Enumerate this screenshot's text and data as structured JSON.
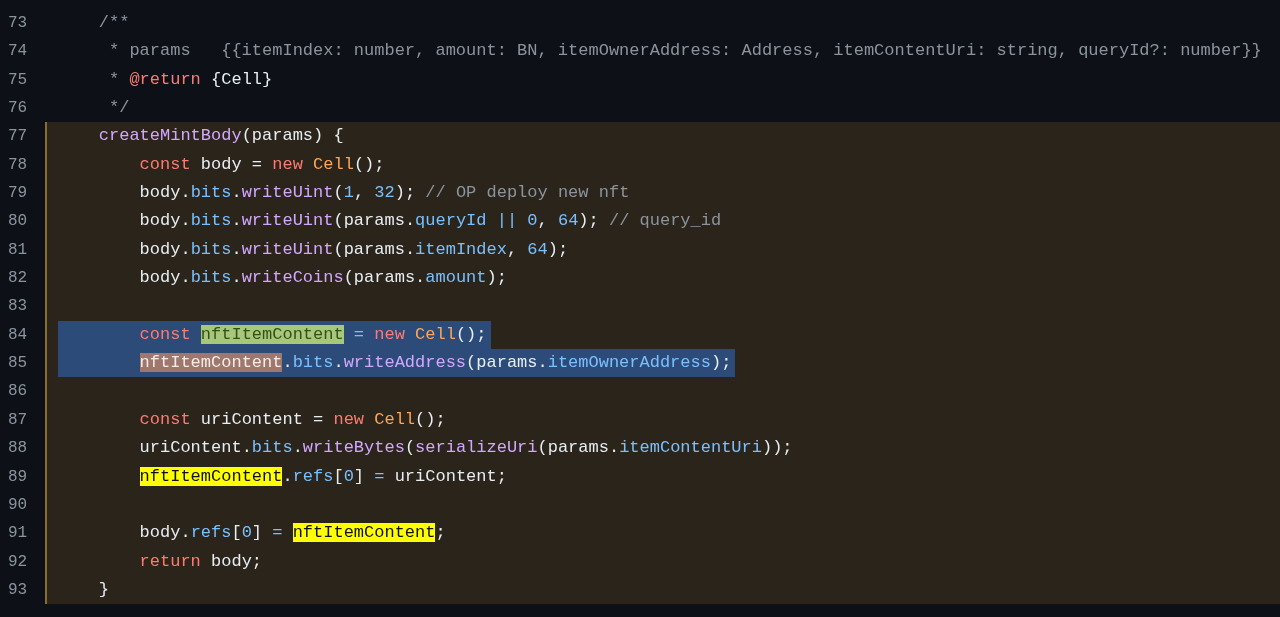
{
  "lines": [
    {
      "number": "73",
      "in_block": false,
      "selected": false,
      "tokens": [
        {
          "text": "/**",
          "kind": "comment"
        }
      ]
    },
    {
      "number": "74",
      "in_block": false,
      "selected": false,
      "tokens": [
        {
          "text": " * params   {{itemIndex: number, amount: BN, itemOwnerAddress: Address, itemContentUri: string, queryId?: number}}",
          "kind": "comment"
        }
      ]
    },
    {
      "number": "75",
      "in_block": false,
      "selected": false,
      "tokens": [
        {
          "text": " * ",
          "kind": "comment"
        },
        {
          "text": "@return",
          "kind": "keyword"
        },
        {
          "text": " {Cell}",
          "kind": "plain"
        }
      ]
    },
    {
      "number": "76",
      "in_block": false,
      "selected": false,
      "tokens": [
        {
          "text": " */",
          "kind": "comment"
        }
      ]
    },
    {
      "number": "77",
      "in_block": true,
      "selected": false,
      "tokens": [
        {
          "text": "createMintBody",
          "kind": "function"
        },
        {
          "text": "(params) {",
          "kind": "plain"
        }
      ],
      "children": [
        {
          "number": "78",
          "in_block": true,
          "selected": false,
          "tokens": [
            {
              "text": "const",
              "kind": "keyword"
            },
            {
              "text": " body = ",
              "kind": "plain"
            },
            {
              "text": "new",
              "kind": "keyword"
            },
            {
              "text": " Cell",
              "kind": "class"
            },
            {
              "text": "();",
              "kind": "plain"
            }
          ]
        },
        {
          "number": "79",
          "in_block": true,
          "selected": false,
          "tokens": [
            {
              "text": "body.",
              "kind": "plain"
            },
            {
              "text": "bits",
              "kind": "property"
            },
            {
              "text": ".",
              "kind": "plain"
            },
            {
              "text": "writeUint",
              "kind": "function"
            },
            {
              "text": "(",
              "kind": "plain"
            },
            {
              "text": "1",
              "kind": "number"
            },
            {
              "text": ", ",
              "kind": "plain"
            },
            {
              "text": "32",
              "kind": "number"
            },
            {
              "text": "); ",
              "kind": "plain"
            },
            {
              "text": "// OP deploy new nft",
              "kind": "comment"
            }
          ]
        },
        {
          "number": "80",
          "in_block": true,
          "selected": false,
          "tokens": [
            {
              "text": "body.",
              "kind": "plain"
            },
            {
              "text": "bits",
              "kind": "property"
            },
            {
              "text": ".",
              "kind": "plain"
            },
            {
              "text": "writeUint",
              "kind": "function"
            },
            {
              "text": "(params.",
              "kind": "plain"
            },
            {
              "text": "queryId",
              "kind": "property"
            },
            {
              "text": " ||",
              "kind": "operator"
            },
            {
              "text": " 0",
              "kind": "number"
            },
            {
              "text": ", ",
              "kind": "plain"
            },
            {
              "text": "64",
              "kind": "number"
            },
            {
              "text": "); ",
              "kind": "plain"
            },
            {
              "text": "// query_id",
              "kind": "comment"
            }
          ]
        },
        {
          "number": "81",
          "in_block": true,
          "selected": false,
          "tokens": [
            {
              "text": "body.",
              "kind": "plain"
            },
            {
              "text": "bits",
              "kind": "property"
            },
            {
              "text": ".",
              "kind": "plain"
            },
            {
              "text": "writeUint",
              "kind": "function"
            },
            {
              "text": "(params.",
              "kind": "plain"
            },
            {
              "text": "itemIndex",
              "kind": "property"
            },
            {
              "text": ", ",
              "kind": "plain"
            },
            {
              "text": "64",
              "kind": "number"
            },
            {
              "text": ");",
              "kind": "plain"
            }
          ]
        },
        {
          "number": "82",
          "in_block": true,
          "selected": false,
          "tokens": [
            {
              "text": "body.",
              "kind": "plain"
            },
            {
              "text": "bits",
              "kind": "property"
            },
            {
              "text": ".",
              "kind": "plain"
            },
            {
              "text": "writeCoins",
              "kind": "function"
            },
            {
              "text": "(params.",
              "kind": "plain"
            },
            {
              "text": "amount",
              "kind": "property"
            },
            {
              "text": ");",
              "kind": "plain"
            }
          ]
        },
        {
          "number": "83",
          "in_block": true,
          "selected": false
        },
        {
          "number": "84",
          "in_block": true,
          "selected": true,
          "tokens": [
            {
              "text": "const ",
              "kind": "keyword"
            },
            {
              "text": "nftItemContent",
              "kind": "current-match"
            },
            {
              "text": " =",
              "kind": "operator"
            },
            {
              "text": " new",
              "kind": "keyword"
            },
            {
              "text": " Cell",
              "kind": "class"
            },
            {
              "text": "();",
              "kind": "plain"
            }
          ]
        },
        {
          "number": "85",
          "in_block": true,
          "selected": true,
          "tokens": [
            {
              "text": "nftItemContent",
              "kind": "selected-match"
            },
            {
              "text": ".",
              "kind": "plain"
            },
            {
              "text": "bits",
              "kind": "property"
            },
            {
              "text": ".",
              "kind": "plain"
            },
            {
              "text": "writeAddress",
              "kind": "function"
            },
            {
              "text": "(params.",
              "kind": "plain"
            },
            {
              "text": "itemOwnerAddress",
              "kind": "property"
            },
            {
              "text": ");",
              "kind": "plain"
            }
          ]
        },
        {
          "number": "86",
          "in_block": true,
          "selected": false
        },
        {
          "number": "87",
          "in_block": true,
          "selected": false,
          "tokens": [
            {
              "text": "const",
              "kind": "keyword"
            },
            {
              "text": " uriContent = ",
              "kind": "plain"
            },
            {
              "text": "new",
              "kind": "keyword"
            },
            {
              "text": " Cell",
              "kind": "class"
            },
            {
              "text": "();",
              "kind": "plain"
            }
          ]
        },
        {
          "number": "88",
          "in_block": true,
          "selected": false,
          "tokens": [
            {
              "text": "uriContent.",
              "kind": "plain"
            },
            {
              "text": "bits",
              "kind": "property"
            },
            {
              "text": ".",
              "kind": "plain"
            },
            {
              "text": "writeBytes",
              "kind": "function"
            },
            {
              "text": "(",
              "kind": "plain"
            },
            {
              "text": "serializeUri",
              "kind": "function"
            },
            {
              "text": "(params.",
              "kind": "plain"
            },
            {
              "text": "itemContentUri",
              "kind": "property"
            },
            {
              "text": "));",
              "kind": "plain"
            }
          ]
        },
        {
          "number": "89",
          "in_block": true,
          "selected": false,
          "tokens": [
            {
              "text": "nftItemContent",
              "kind": "match"
            },
            {
              "text": ".",
              "kind": "plain"
            },
            {
              "text": "refs",
              "kind": "property"
            },
            {
              "text": "[",
              "kind": "plain"
            },
            {
              "text": "0",
              "kind": "number"
            },
            {
              "text": "] ",
              "kind": "plain"
            },
            {
              "text": "=",
              "kind": "operator"
            },
            {
              "text": " uriContent;",
              "kind": "plain"
            }
          ]
        },
        {
          "number": "90",
          "in_block": true,
          "selected": false
        },
        {
          "number": "91",
          "in_block": true,
          "selected": false,
          "tokens": [
            {
              "text": "body.",
              "kind": "plain"
            },
            {
              "text": "refs",
              "kind": "property"
            },
            {
              "text": "[",
              "kind": "plain"
            },
            {
              "text": "0",
              "kind": "number"
            },
            {
              "text": "] ",
              "kind": "plain"
            },
            {
              "text": "= ",
              "kind": "operator"
            },
            {
              "text": "nftItemContent",
              "kind": "match"
            },
            {
              "text": ";",
              "kind": "plain"
            }
          ]
        },
        {
          "number": "92",
          "in_block": true,
          "selected": false,
          "tokens": [
            {
              "text": "return",
              "kind": "keyword"
            },
            {
              "text": " body;",
              "kind": "plain"
            }
          ]
        }
      ]
    },
    {
      "number": "93",
      "in_block": true,
      "selected": false,
      "tokens": [
        {
          "text": "}",
          "kind": "plain"
        }
      ]
    }
  ]
}
